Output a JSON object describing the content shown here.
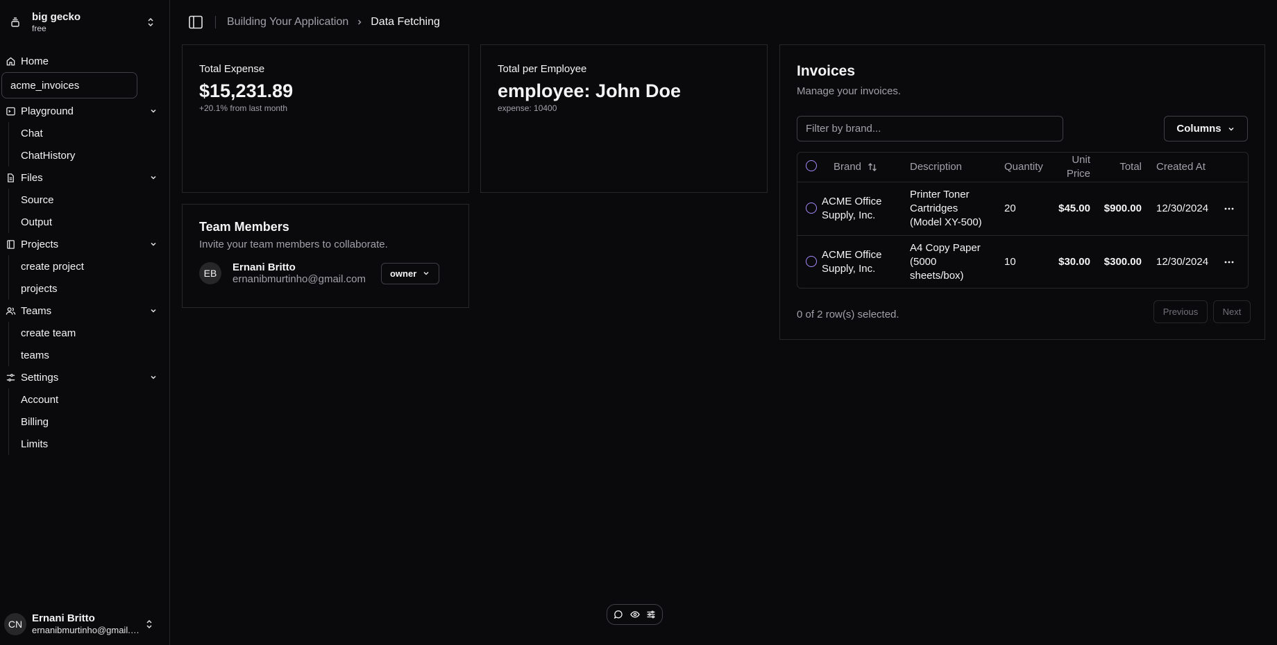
{
  "sidebar": {
    "org": {
      "name": "big gecko",
      "plan": "free"
    },
    "home": "Home",
    "active": "acme_invoices",
    "sections": [
      {
        "label": "Playground",
        "items": [
          "Chat",
          "ChatHistory"
        ]
      },
      {
        "label": "Files",
        "items": [
          "Source",
          "Output"
        ]
      },
      {
        "label": "Projects",
        "items": [
          "create project",
          "projects"
        ]
      },
      {
        "label": "Teams",
        "items": [
          "create team",
          "teams"
        ]
      },
      {
        "label": "Settings",
        "items": [
          "Account",
          "Billing",
          "Limits"
        ]
      }
    ],
    "user": {
      "initials": "CN",
      "name": "Ernani Britto",
      "email": "ernanibmurtinho@gmail.com"
    }
  },
  "breadcrumb": {
    "parent": "Building Your Application",
    "current": "Data Fetching"
  },
  "expense_card": {
    "label": "Total Expense",
    "value": "$15,231.89",
    "note": "+20.1% from last month"
  },
  "employee_card": {
    "label": "Total per Employee",
    "value": "employee: John Doe",
    "note": "expense: 10400"
  },
  "team_card": {
    "title": "Team Members",
    "subtitle": "Invite your team members to collaborate.",
    "member": {
      "initials": "EB",
      "name": "Ernani Britto",
      "email": "ernanibmurtinho@gmail.com",
      "role": "owner"
    }
  },
  "invoices": {
    "title": "Invoices",
    "subtitle": "Manage your invoices.",
    "filter_placeholder": "Filter by brand...",
    "columns_label": "Columns",
    "headers": {
      "brand": "Brand",
      "description": "Description",
      "quantity": "Quantity",
      "unit_price_1": "Unit",
      "unit_price_2": "Price",
      "total": "Total",
      "created_at": "Created At"
    },
    "rows": [
      {
        "brand_1": "ACME Office",
        "brand_2": "Supply, Inc.",
        "desc_1": "Printer Toner",
        "desc_2": "Cartridges",
        "desc_3": "(Model XY-500)",
        "quantity": "20",
        "unit_price": "$45.00",
        "total": "$900.00",
        "created_at": "12/30/2024"
      },
      {
        "brand_1": "ACME Office",
        "brand_2": "Supply, Inc.",
        "desc_1": "A4 Copy Paper",
        "desc_2": "(5000",
        "desc_3": "sheets/box)",
        "quantity": "10",
        "unit_price": "$30.00",
        "total": "$300.00",
        "created_at": "12/30/2024"
      }
    ],
    "selection": "0 of 2 row(s) selected.",
    "previous": "Previous",
    "next": "Next"
  },
  "icons": {
    "org": "layers-icon",
    "home": "home-icon",
    "playground": "terminal-icon",
    "files": "file-icon",
    "projects": "book-icon",
    "teams": "users-icon",
    "settings": "sliders-icon",
    "sidebar_toggle": "panel-left-icon",
    "sort": "arrow-up-down-icon",
    "more": "ellipsis-icon",
    "float": [
      "message-icon",
      "eye-icon",
      "settings-icon"
    ]
  },
  "colors": {
    "background": "#0a0a0c",
    "border": "#27272a",
    "accent": "#a78bfa",
    "muted": "#a1a1aa"
  }
}
